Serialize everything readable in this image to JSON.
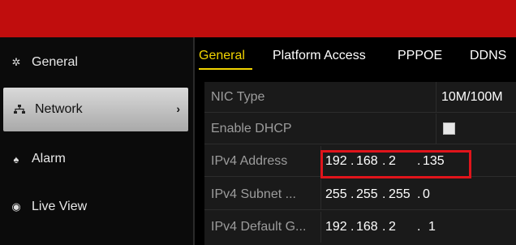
{
  "sidebar": {
    "items": [
      {
        "label": "General",
        "icon": "gear-icon"
      },
      {
        "label": "Network",
        "icon": "network-icon",
        "active": true
      },
      {
        "label": "Alarm",
        "icon": "bell-icon"
      },
      {
        "label": "Live View",
        "icon": "eye-icon"
      }
    ]
  },
  "tabs": [
    {
      "label": "General",
      "active": true
    },
    {
      "label": "Platform Access"
    },
    {
      "label": "PPPOE"
    },
    {
      "label": "DDNS"
    }
  ],
  "form": {
    "nic_type_label": "NIC Type",
    "nic_type_value": "10M/100M",
    "dhcp_label": "Enable DHCP",
    "dhcp_checked": false,
    "ipv4_address_label": "IPv4 Address",
    "ipv4_address": [
      "192",
      "168",
      "2",
      "135"
    ],
    "ipv4_subnet_label": "IPv4 Subnet ...",
    "ipv4_subnet": [
      "255",
      "255",
      "255",
      "0"
    ],
    "ipv4_gateway_label": "IPv4 Default G...",
    "ipv4_gateway": [
      "192",
      "168",
      "2",
      "1"
    ]
  },
  "colors": {
    "topbar": "#c00d0d",
    "active_tab": "#f2d400",
    "highlight": "#e0141b"
  }
}
